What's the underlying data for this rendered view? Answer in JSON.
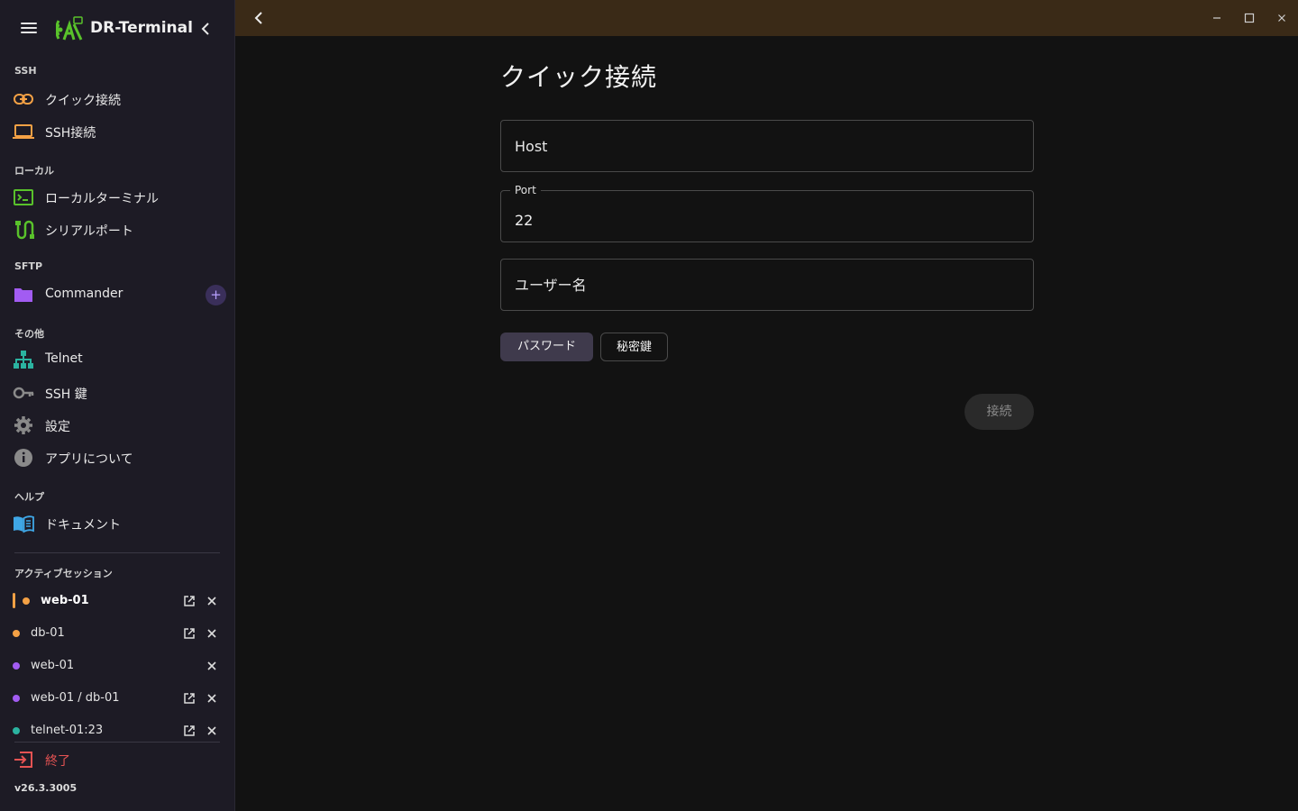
{
  "app": {
    "name": "DR-Terminal",
    "version": "v26.3.3005"
  },
  "sections": {
    "ssh": "SSH",
    "local": "ローカル",
    "sftp": "SFTP",
    "other": "その他",
    "help": "ヘルプ",
    "sessions": "アクティブセッション"
  },
  "nav": {
    "quick_connect": "クイック接続",
    "ssh_connect": "SSH接続",
    "local_terminal": "ローカルターミナル",
    "serial_port": "シリアルポート",
    "commander": "Commander",
    "telnet": "Telnet",
    "ssh_keys": "SSH 鍵",
    "settings": "設定",
    "about": "アプリについて",
    "docs": "ドキュメント",
    "quit": "終了"
  },
  "sessions": [
    {
      "name": "web-01",
      "color": "#f4a145",
      "popout": true
    },
    {
      "name": "db-01",
      "color": "#f4a145",
      "popout": true
    },
    {
      "name": "web-01",
      "color": "#a25cf2",
      "popout": false
    },
    {
      "name": "web-01 / db-01",
      "color": "#a25cf2",
      "popout": true
    },
    {
      "name": "telnet-01:23",
      "color": "#2bb3a0",
      "popout": true
    }
  ],
  "form": {
    "title": "クイック接続",
    "host_placeholder": "Host",
    "port_label": "Port",
    "port_value": "22",
    "username_placeholder": "ユーザー名",
    "auth_password": "パスワード",
    "auth_key": "秘密鍵",
    "connect": "接続"
  },
  "colors": {
    "titlebar": "#3a2a17",
    "sidebar": "#1d1b25",
    "accent_orange": "#f4a145",
    "accent_purple": "#a25cf2",
    "accent_teal": "#2bb3a0",
    "quit": "#e55353"
  }
}
